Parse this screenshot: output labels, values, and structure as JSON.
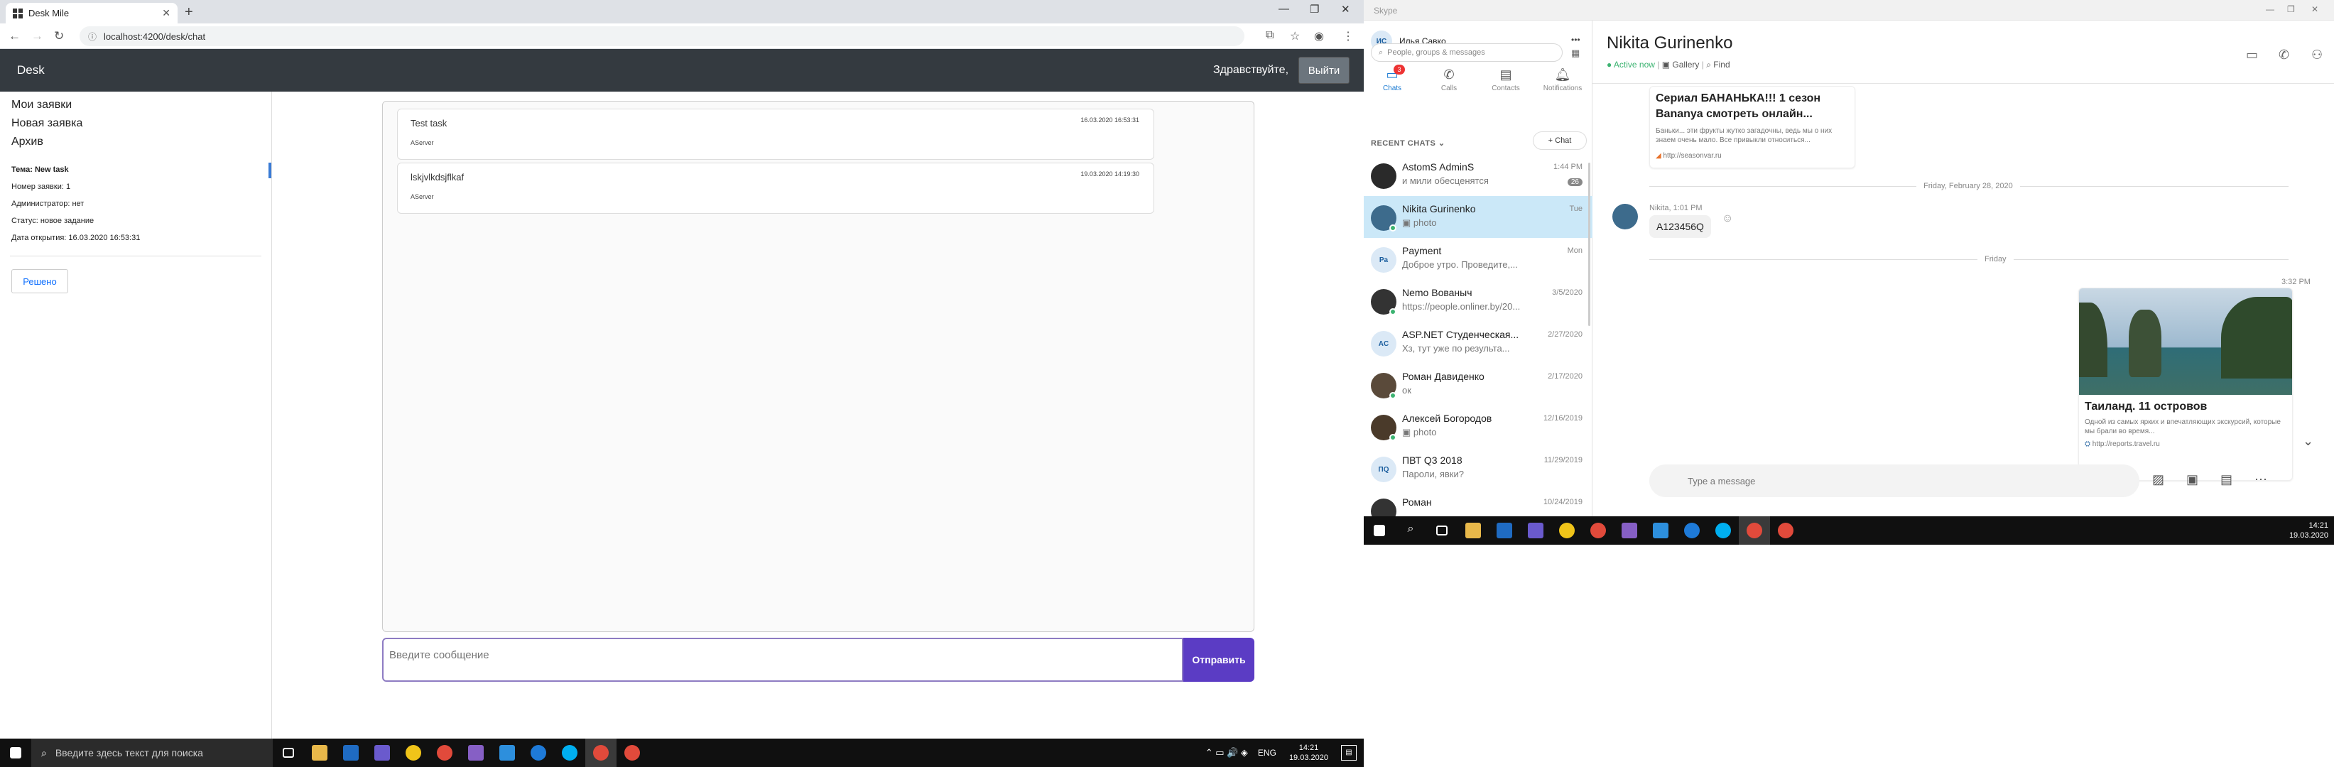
{
  "chrome": {
    "tab_title": "Desk Mile",
    "tab_close": "✕",
    "new_tab": "+",
    "url": "localhost:4200/desk/chat",
    "win_min": "—",
    "win_max": "❐",
    "win_close": "✕"
  },
  "desk": {
    "brand": "Desk",
    "greeting": "Здравствуйте,",
    "logout_label": "Выйти",
    "nav": [
      "Мои заявки",
      "Новая заявка",
      "Архив"
    ],
    "details": {
      "topic": "Тема: New task",
      "number": "Номер заявки: 1",
      "admin": "Администратор: нет",
      "status": "Статус: новое задание",
      "opened": "Дата открытия: 16.03.2020 16:53:31"
    },
    "resolved_label": "Решено",
    "tasks": [
      {
        "title": "Test task",
        "date": "16.03.2020 16:53:31",
        "author": "AServer"
      },
      {
        "title": "lskjvlkdsjflkaf",
        "date": "19.03.2020 14:19:30",
        "author": "AServer"
      }
    ],
    "message_placeholder": "Введите сообщение",
    "send_label": "Отправить"
  },
  "taskbar_main": {
    "search_placeholder": "Введите здесь текст для поиска",
    "lang": "ENG",
    "time": "14:21",
    "date": "19.03.2020"
  },
  "skype": {
    "window_title": "Skype",
    "user_initials": "ИС",
    "user_name": "Илья Савко",
    "more": "•••",
    "search_placeholder": "People, groups & messages",
    "tabs": [
      {
        "label": "Chats",
        "badge": "3"
      },
      {
        "label": "Calls"
      },
      {
        "label": "Contacts"
      },
      {
        "label": "Notifications"
      }
    ],
    "recent_label": "RECENT CHATS ⌄",
    "new_chat": "+ Chat",
    "chats": [
      {
        "name": "AstomS AdminS",
        "preview": "и мили обесценятся",
        "time": "1:44 PM",
        "count": "26",
        "initials": "",
        "color": "#2a2a2a"
      },
      {
        "name": "Nikita Gurinenko",
        "preview": "▣ photo",
        "time": "Tue",
        "initials": "",
        "color": "#3d6b8c"
      },
      {
        "name": "Payment",
        "preview": "Доброе утро. Проведите,...",
        "time": "Mon",
        "initials": "Pa",
        "color": "#dbe9f6"
      },
      {
        "name": "Nemo Вованыч",
        "preview": "https://people.onliner.by/20...",
        "time": "3/5/2020",
        "initials": "",
        "color": "#333"
      },
      {
        "name": "ASP.NET Студенческая...",
        "preview": "Хз, тут уже по результа...",
        "time": "2/27/2020",
        "initials": "AC",
        "color": "#dbe9f6"
      },
      {
        "name": "Роман Давиденко",
        "preview": "ок",
        "time": "2/17/2020",
        "initials": "",
        "color": "#5a4a3a"
      },
      {
        "name": "Алексей Богородов",
        "preview": "▣ photo",
        "time": "12/16/2019",
        "initials": "",
        "color": "#4a3a2a"
      },
      {
        "name": "ПВТ Q3 2018",
        "preview": "Пароли, явки?",
        "time": "11/29/2019",
        "initials": "ПQ",
        "color": "#dbe9f6"
      },
      {
        "name": "Роман",
        "preview": "",
        "time": "10/24/2019",
        "initials": "",
        "color": "#333"
      }
    ],
    "conversation": {
      "name": "Nikita Gurinenko",
      "status": "● Active now",
      "gallery": "▣ Gallery",
      "find": "⌕ Find",
      "link_card": {
        "title": "Сериал БАНАНЬКА!!! 1 сезон Bananya смотреть онлайн...",
        "desc": "Баньки... эти фрукты жутко загадочны, ведь мы о них знаем очень мало. Все привыкли относиться...",
        "url": "http://seasonvar.ru"
      },
      "date_1": "Friday, February 28, 2020",
      "msg_meta": "Nikita, 1:01 PM",
      "msg_text": "A123456Q",
      "date_2": "Friday",
      "msg2_time": "3:32 PM",
      "image_card": {
        "title": "Таиланд. 11 островов",
        "desc": "Одной из самых ярких и впечатляющих экскурсий, которые мы брали во время...",
        "url": "http://reports.travel.ru"
      },
      "composer_placeholder": "Type a message"
    }
  },
  "taskbar_skype": {
    "time": "14:21",
    "date": "19.03.2020"
  }
}
